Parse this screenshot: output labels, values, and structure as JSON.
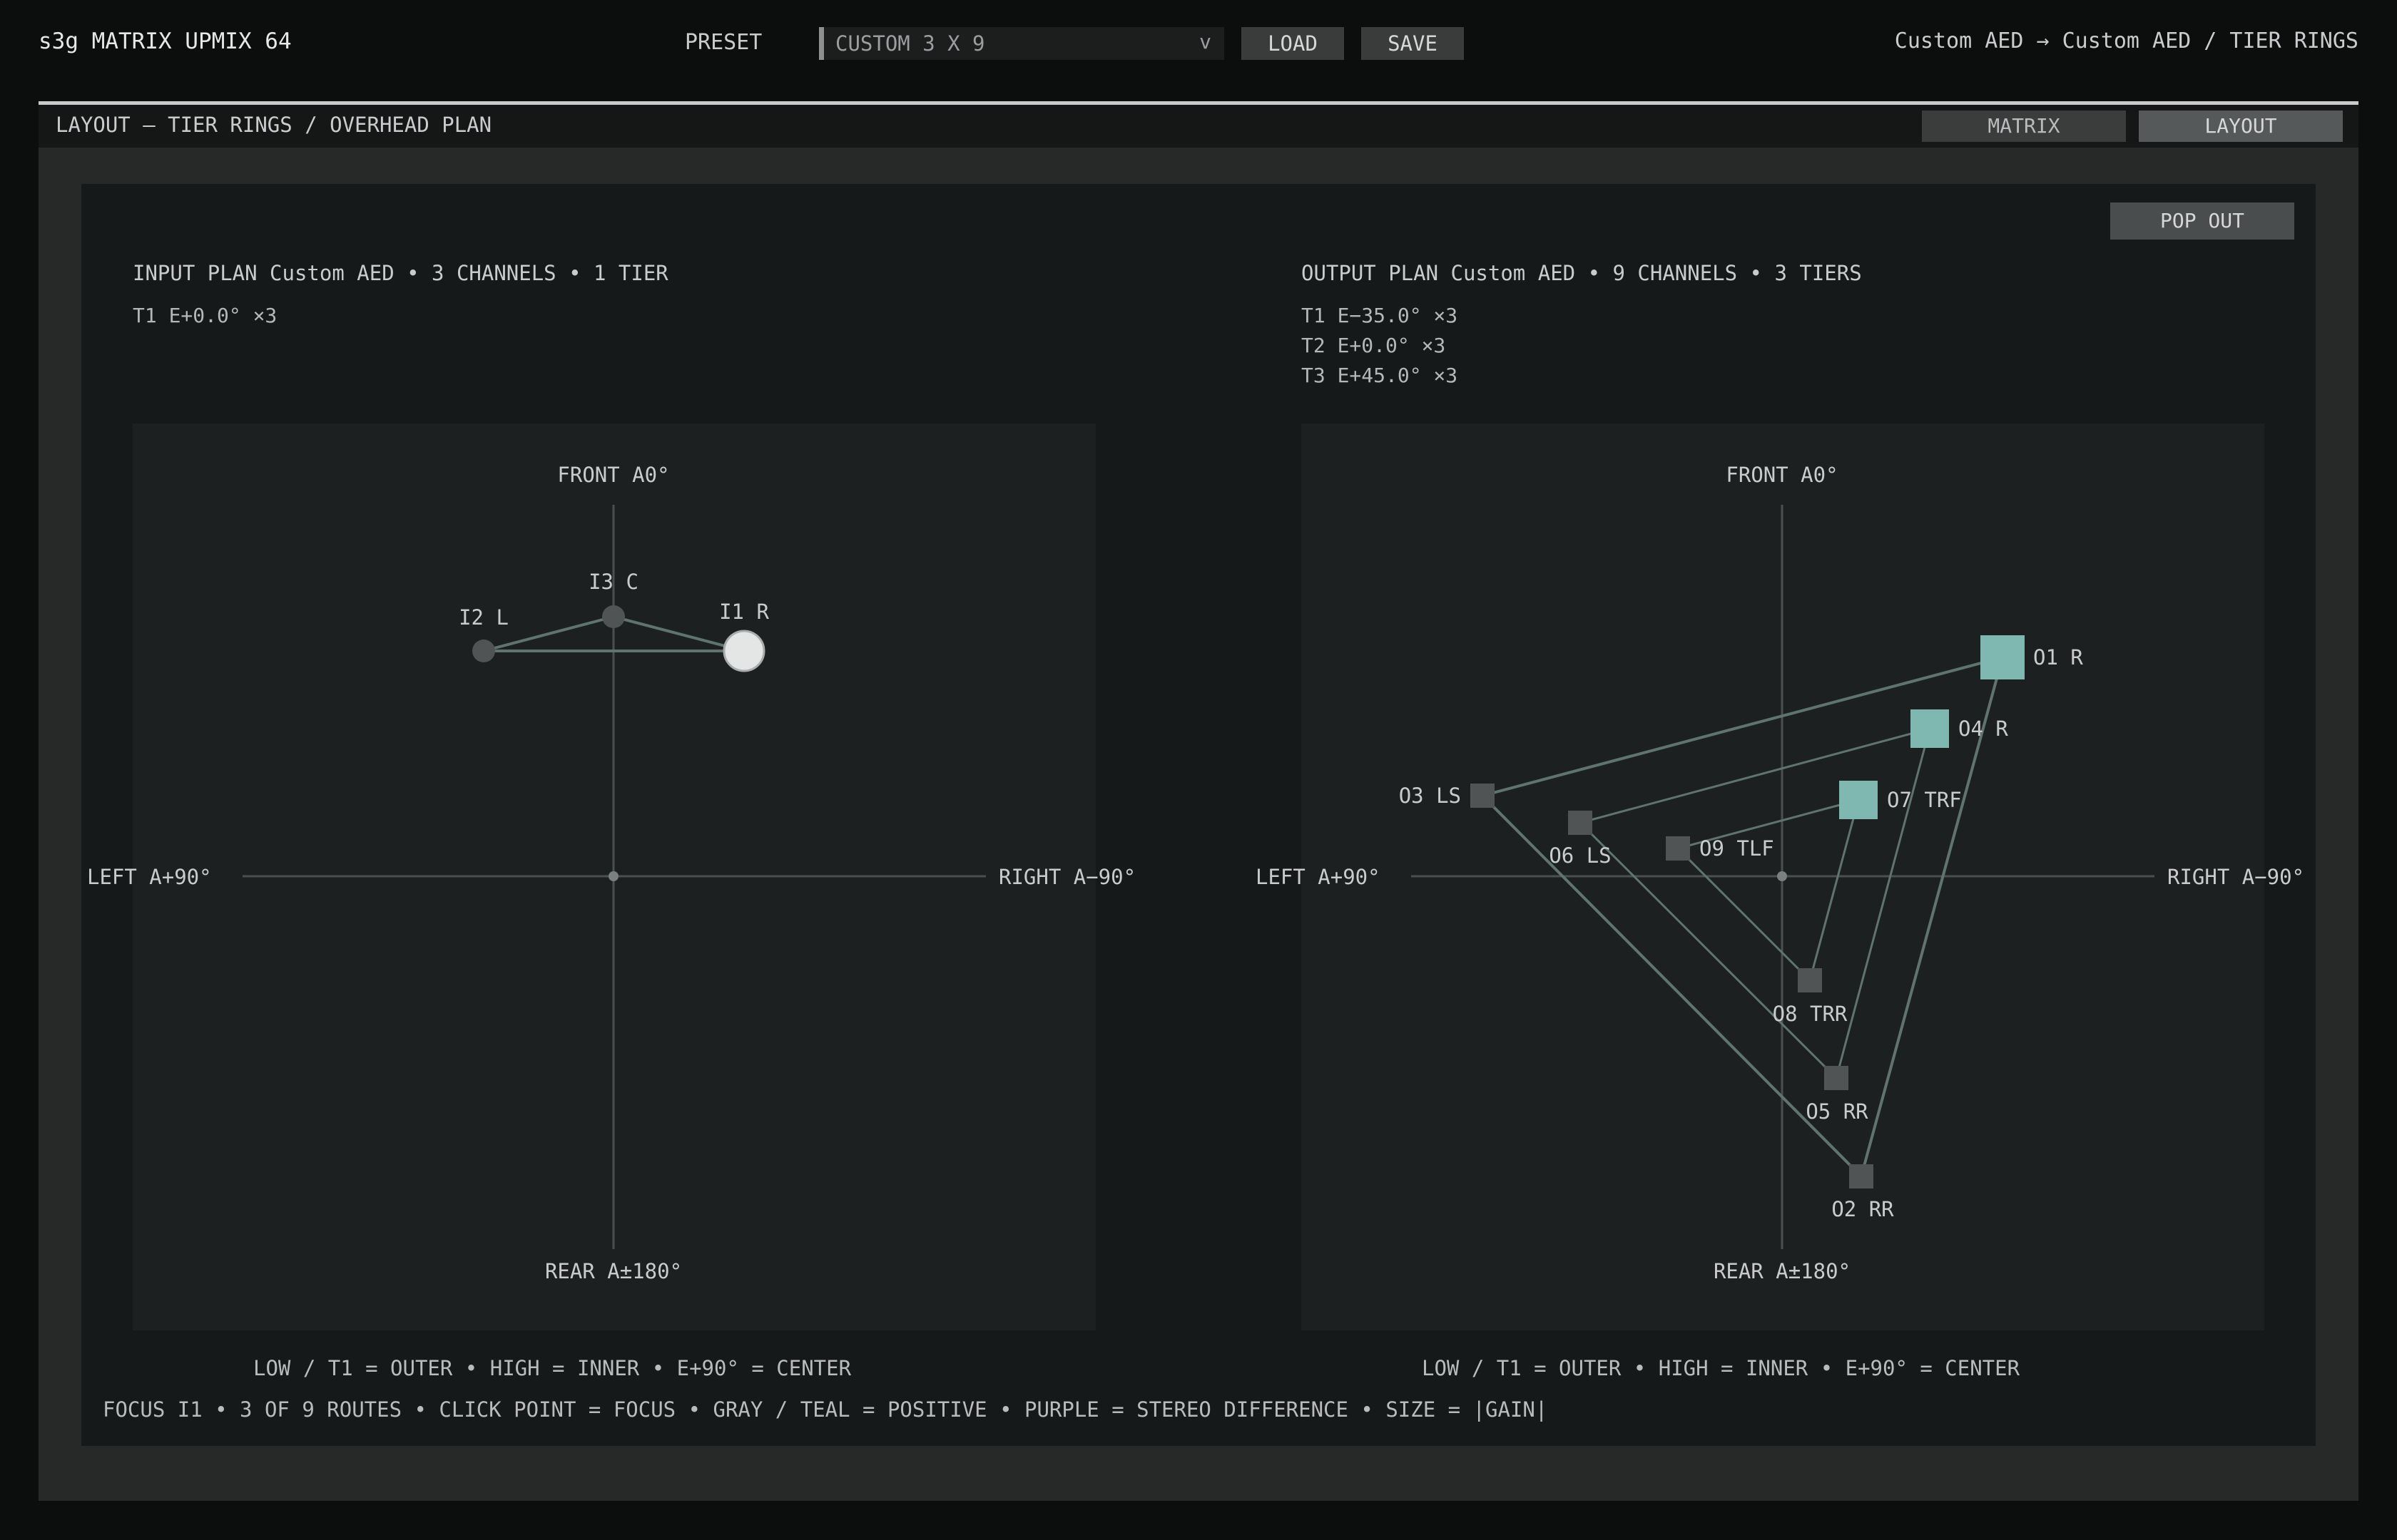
{
  "app": {
    "title": "s3g MATRIX UPMIX 64"
  },
  "toolbar": {
    "preset_label": "PRESET",
    "preset_value": "CUSTOM 3 X 9",
    "preset_chevron": "v",
    "load_label": "LOAD",
    "save_label": "SAVE",
    "route_summary": "Custom AED → Custom AED / TIER RINGS"
  },
  "section": {
    "title": "LAYOUT — TIER RINGS / OVERHEAD PLAN",
    "tabs": [
      {
        "label": "MATRIX",
        "active": false
      },
      {
        "label": "LAYOUT",
        "active": true
      }
    ],
    "popout_label": "POP OUT"
  },
  "input_plan": {
    "header": "INPUT PLAN   Custom AED   •   3 CHANNELS   •   1 TIER",
    "tiers": [
      "T1  E+0.0°  ×3"
    ],
    "axes": {
      "front": "FRONT  A0°",
      "rear": "REAR  A±180°",
      "left": "LEFT  A+90°",
      "right": "RIGHT  A−90°"
    },
    "nodes": [
      {
        "id": "I1",
        "label": "I1 R",
        "azimuth_deg": -30,
        "elevation_deg": 0,
        "focused": true
      },
      {
        "id": "I2",
        "label": "I2 L",
        "azimuth_deg": 30,
        "elevation_deg": 0,
        "focused": false
      },
      {
        "id": "I3",
        "label": "I3 C",
        "azimuth_deg": 0,
        "elevation_deg": 0,
        "focused": false
      }
    ],
    "legend": "LOW / T1 = OUTER   •   HIGH = INNER   •   E+90° = CENTER"
  },
  "output_plan": {
    "header": "OUTPUT PLAN   Custom AED   •   9 CHANNELS   •   3 TIERS",
    "tiers": [
      "T1  E−35.0°  ×3",
      "T2  E+0.0°  ×3",
      "T3  E+45.0°  ×3"
    ],
    "axes": {
      "front": "FRONT  A0°",
      "rear": "REAR  A±180°",
      "left": "LEFT  A+90°",
      "right": "RIGHT  A−90°"
    },
    "nodes": [
      {
        "id": "O1",
        "label": "O1 R",
        "tier": "T1",
        "gain": 1.0,
        "routed": true
      },
      {
        "id": "O2",
        "label": "O2 RR",
        "tier": "T1",
        "gain": 0.0,
        "routed": false
      },
      {
        "id": "O3",
        "label": "O3 LS",
        "tier": "T1",
        "gain": 0.0,
        "routed": false
      },
      {
        "id": "O4",
        "label": "O4 R",
        "tier": "T2",
        "gain": 0.85,
        "routed": true
      },
      {
        "id": "O5",
        "label": "O5 RR",
        "tier": "T2",
        "gain": 0.0,
        "routed": false
      },
      {
        "id": "O6",
        "label": "O6 LS",
        "tier": "T2",
        "gain": 0.0,
        "routed": false
      },
      {
        "id": "O7",
        "label": "O7 TRF",
        "tier": "T3",
        "gain": 0.85,
        "routed": true
      },
      {
        "id": "O8",
        "label": "O8 TRR",
        "tier": "T3",
        "gain": 0.0,
        "routed": false
      },
      {
        "id": "O9",
        "label": "O9 TLF",
        "tier": "T3",
        "gain": 0.0,
        "routed": false
      }
    ],
    "legend": "LOW / T1 = OUTER   •   HIGH = INNER   •   E+90° = CENTER"
  },
  "footer": {
    "text": "FOCUS I1   •   3 OF 9 ROUTES   •   CLICK POINT = FOCUS   •   GRAY / TEAL = POSITIVE   •   PURPLE = STEREO DIFFERENCE   •   SIZE = |GAIN|"
  },
  "colors": {
    "teal": "#7fb8b0",
    "gray_node": "#505454",
    "focus_node": "#e4e6e6",
    "axis": "#4a5050",
    "link": "#5f736f"
  }
}
